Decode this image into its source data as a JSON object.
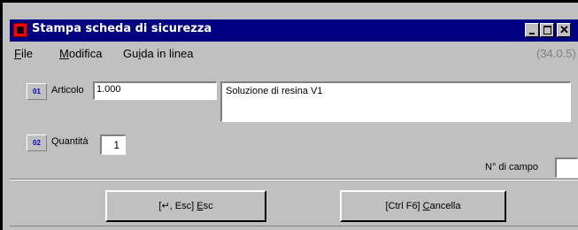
{
  "window": {
    "title": "Stampa scheda di sicurezza",
    "icon": "app-icon",
    "controls": {
      "minimize": "minimize-icon",
      "maximize": "maximize-icon",
      "close": "✕"
    }
  },
  "menu": {
    "file": {
      "mnemonic": "F",
      "rest": "ile"
    },
    "modifica": {
      "mnemonic": "M",
      "rest": "odifica"
    },
    "guida": {
      "pre": "Gu",
      "mnemonic": "i",
      "rest": "da in linea"
    },
    "version": "(34.0.5)"
  },
  "fields": {
    "articolo": {
      "badge": "01",
      "label": "Articolo",
      "value": "1.000",
      "description": "Soluzione di resina V1"
    },
    "quantita": {
      "badge": "02",
      "label": "Quantità",
      "value": "1"
    },
    "campo": {
      "label": "N° di campo",
      "value": ""
    }
  },
  "buttons": {
    "ok": {
      "prefix": "[↵, Esc] ",
      "mnemonic": "E",
      "rest": "sc"
    },
    "cancel": {
      "prefix": "[Ctrl F6] ",
      "mnemonic": "C",
      "rest": "ancella"
    }
  },
  "colors": {
    "titlebar": "#000080",
    "face": "#c0c0c0",
    "badge_text": "#0000c0",
    "version_text": "#808080"
  }
}
